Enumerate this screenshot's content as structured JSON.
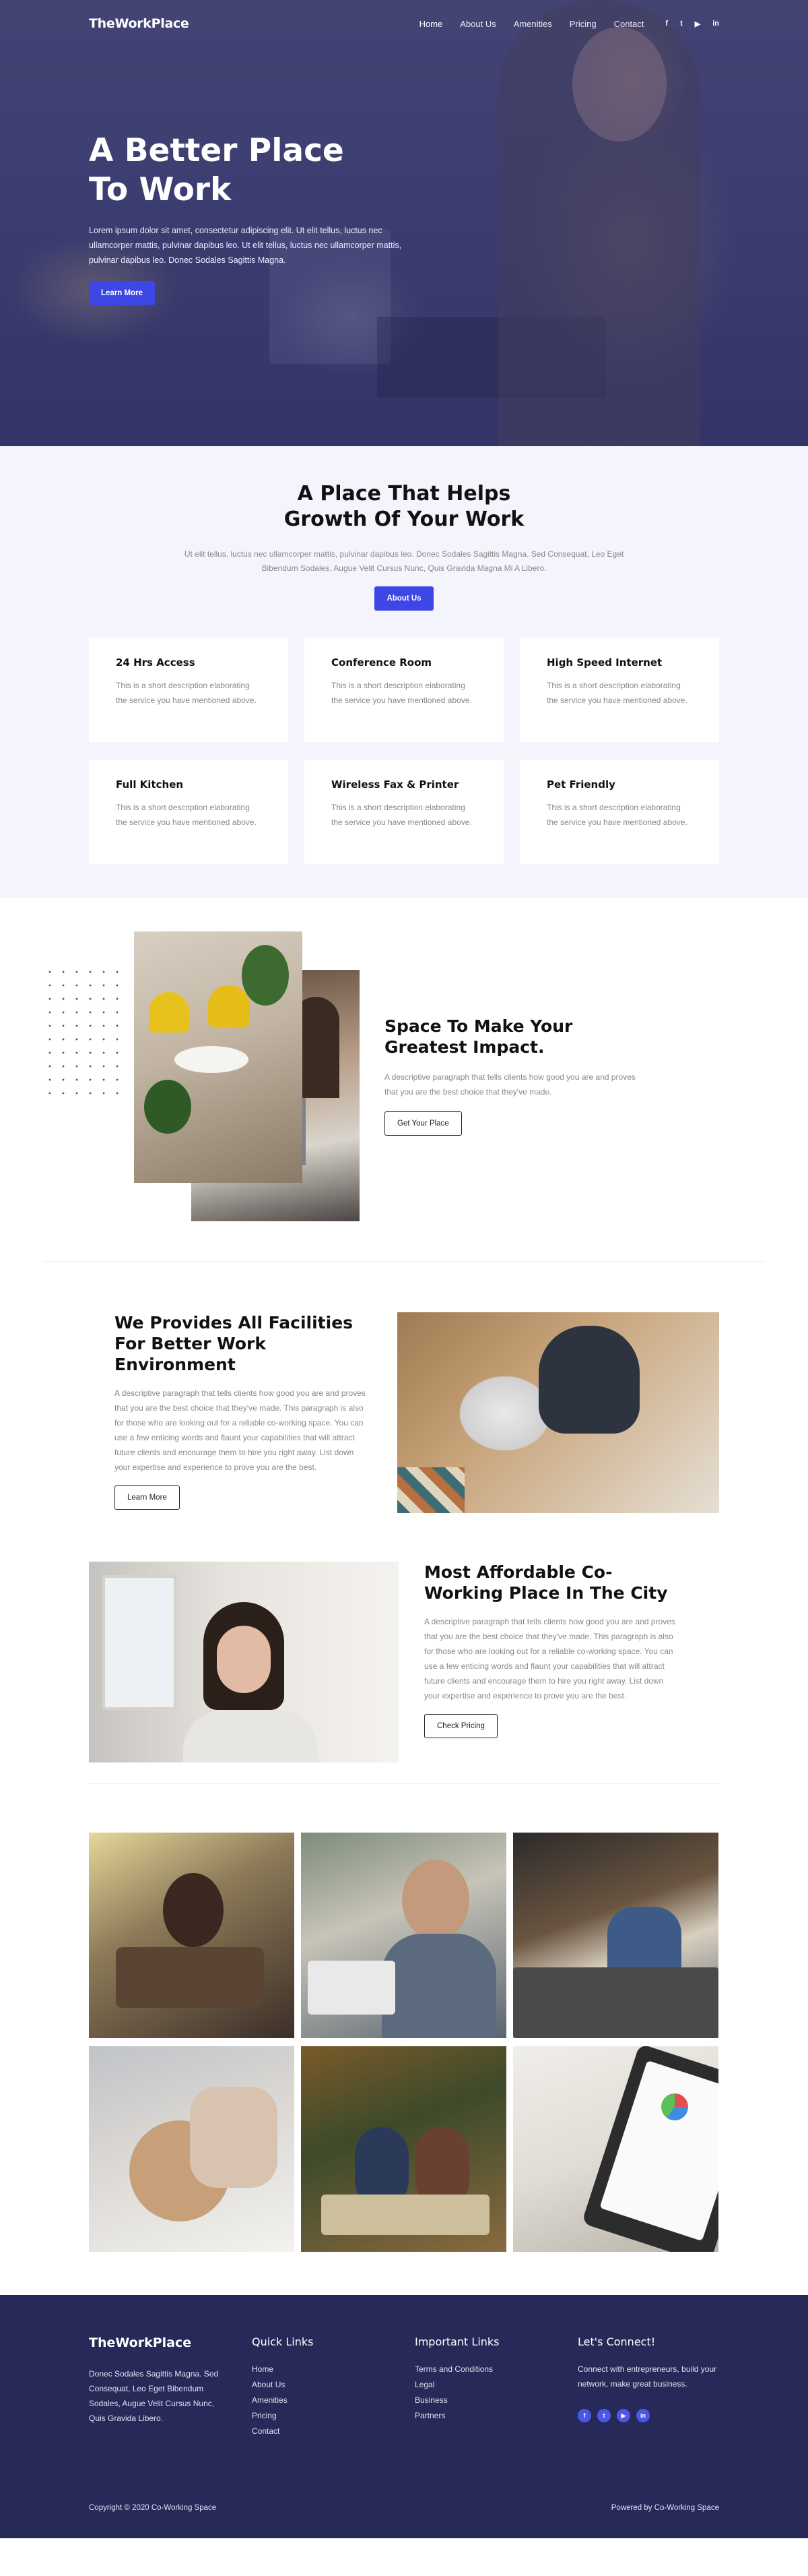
{
  "brand": "TheWorkPlace",
  "nav": {
    "items": [
      "Home",
      "About Us",
      "Amenities",
      "Pricing",
      "Contact"
    ],
    "social": [
      "f",
      "t",
      "y",
      "in"
    ]
  },
  "hero": {
    "title": "A Better Place To Work",
    "subtitle": "Lorem ipsum dolor sit amet, consectetur adipiscing elit. Ut elit tellus, luctus nec ullamcorper mattis, pulvinar dapibus leo. Ut elit tellus, luctus nec ullamcorper mattis, pulvinar dapibus leo. Donec Sodales Sagittis Magna.",
    "button": "Learn More"
  },
  "growth": {
    "title": "A Place That Helps Growth Of Your Work",
    "subtitle": "Ut elit tellus, luctus nec ullamcorper mattis, pulvinar dapibus leo. Donec Sodales Sagittis Magna. Sed Consequat, Leo Eget Bibendum Sodales, Augue Velit Cursus Nunc, Quis Gravida Magna Mi A Libero.",
    "button": "About Us",
    "features": [
      {
        "title": "24 Hrs Access",
        "desc": "This is a short description elaborating the service you have mentioned above."
      },
      {
        "title": "Conference Room",
        "desc": "This is a short description elaborating the service you have mentioned above."
      },
      {
        "title": "High Speed Internet",
        "desc": "This is a short description elaborating the service you have mentioned above."
      },
      {
        "title": "Full Kitchen",
        "desc": "This is a short description elaborating the service you have mentioned above."
      },
      {
        "title": "Wireless Fax & Printer",
        "desc": "This is a short description elaborating the service you have mentioned above."
      },
      {
        "title": "Pet Friendly",
        "desc": "This is a short description elaborating the service you have mentioned above."
      }
    ]
  },
  "impact": {
    "title": "Space To Make Your Greatest Impact.",
    "desc": "A descriptive paragraph that tells clients how good you are and proves that you are the best choice that they've made.",
    "button": "Get Your Place"
  },
  "facilities": {
    "title": "We Provides All Facilities For Better Work Environment",
    "desc": "A descriptive paragraph that tells clients how good you are and proves that you are the best choice that they've made. This paragraph is also for those who are looking out for a reliable co-working space. You can use a few enticing words and flaunt your capabilities that will attract future clients and encourage them to hire you right away. List down your expertise and experience to prove you are the best.",
    "button": "Learn More"
  },
  "affordable": {
    "title": "Most Affordable Co-Working Place In The City",
    "desc": "A descriptive paragraph that tells clients how good you are and proves that you are the best choice that they've made. This paragraph is also for those who are looking out for a reliable co-working space. You can use a few enticing words and flaunt your capabilities that will attract future clients and encourage them to hire you right away. List down your expertise and experience to prove you are the best.",
    "button": "Check Pricing"
  },
  "footer": {
    "logo": "TheWorkPlace",
    "desc": "Donec Sodales Sagittis Magna. Sed Consequat, Leo Eget Bibendum Sodales, Augue Velit Cursus Nunc, Quis Gravida Libero.",
    "quick_title": "Quick Links",
    "quick_links": [
      "Home",
      "About Us",
      "Amenities",
      "Pricing",
      "Contact"
    ],
    "important_title": "Important Links",
    "important_links": [
      "Terms and Conditions",
      "Legal",
      "Business",
      "Partners"
    ],
    "connect_title": "Let's Connect!",
    "connect_desc": "Connect with entrepreneurs, build your network, make great business.",
    "social": [
      "f",
      "t",
      "y",
      "in"
    ],
    "copyright": "Copyright © 2020 Co-Working Space",
    "powered": "Powered by Co-Working Space"
  },
  "colors": {
    "accent": "#3d47e6",
    "footer_bg": "#272a58",
    "section_bg": "#f4f5fc"
  }
}
